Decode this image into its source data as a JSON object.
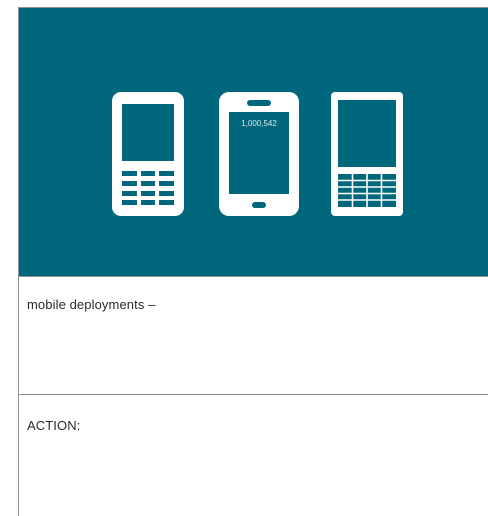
{
  "hero": {
    "background_color": "#00677c",
    "phones": [
      {
        "name": "feature-phone",
        "icon": "feature-phone-icon"
      },
      {
        "name": "smartphone",
        "icon": "smartphone-icon",
        "counter": "1,000,542"
      },
      {
        "name": "qwerty-phone",
        "icon": "qwerty-phone-icon"
      }
    ]
  },
  "sections": {
    "mobile_deployments_label": "mobile deployments –",
    "action_label": "ACTION:"
  }
}
